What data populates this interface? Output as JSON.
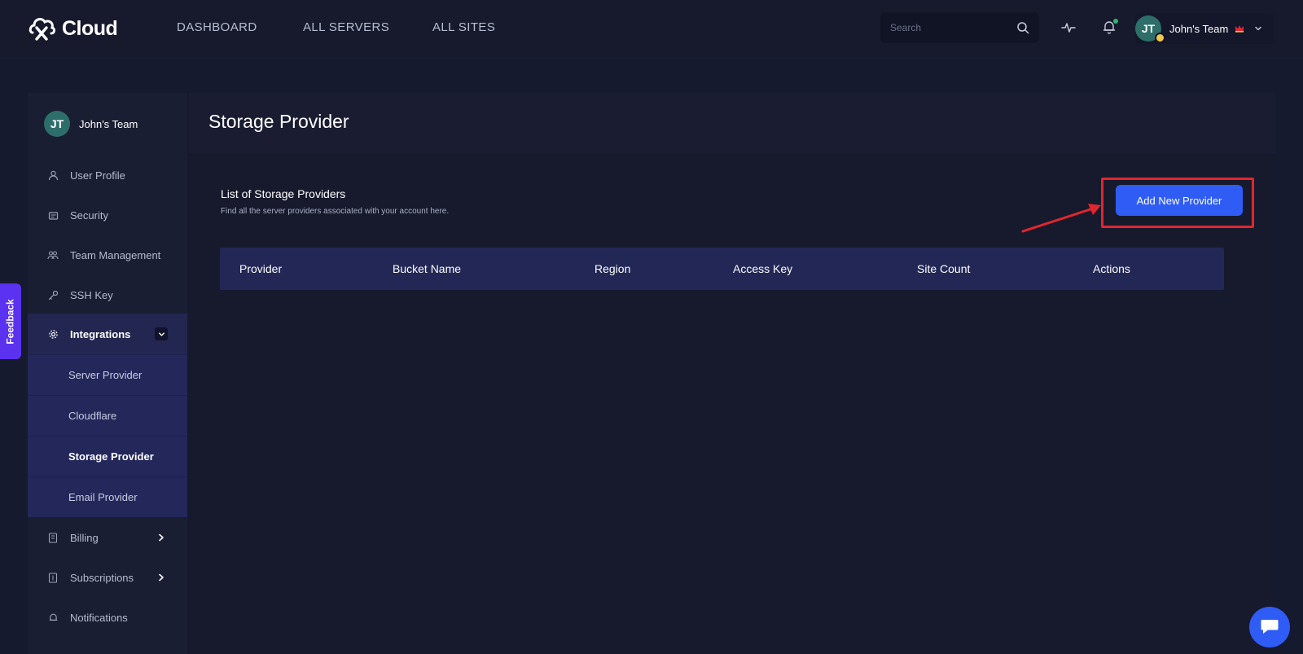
{
  "brand": {
    "name": "Cloud"
  },
  "nav": {
    "links": [
      "DASHBOARD",
      "ALL SERVERS",
      "ALL SITES"
    ]
  },
  "search": {
    "placeholder": "Search"
  },
  "account": {
    "initials": "JT",
    "team_name": "John's Team"
  },
  "sidebar": {
    "user": {
      "initials": "JT",
      "name": "John's Team"
    },
    "items": [
      {
        "label": "User Profile",
        "icon": "user-icon"
      },
      {
        "label": "Security",
        "icon": "security-icon"
      },
      {
        "label": "Team Management",
        "icon": "team-icon"
      },
      {
        "label": "SSH Key",
        "icon": "key-icon"
      },
      {
        "label": "Integrations",
        "icon": "gear-icon",
        "expanded": true
      },
      {
        "label": "Billing",
        "icon": "billing-icon"
      },
      {
        "label": "Subscriptions",
        "icon": "subscriptions-icon"
      },
      {
        "label": "Notifications",
        "icon": "bell-icon"
      }
    ],
    "integrations_sub": [
      {
        "label": "Server Provider"
      },
      {
        "label": "Cloudflare"
      },
      {
        "label": "Storage Provider",
        "current": true
      },
      {
        "label": "Email Provider"
      }
    ]
  },
  "feedback": {
    "label": "Feedback"
  },
  "main": {
    "title": "Storage Provider",
    "list_title": "List of Storage Providers",
    "list_subtitle": "Find all the server providers associated with your account here.",
    "add_button": "Add New Provider",
    "table": {
      "columns": [
        "Provider",
        "Bucket Name",
        "Region",
        "Access Key",
        "Site Count",
        "Actions"
      ],
      "rows": []
    }
  },
  "colors": {
    "accent": "#2f5cf5",
    "highlight": "#e0262e",
    "feedback": "#5b32f0",
    "table_header": "#232755"
  }
}
